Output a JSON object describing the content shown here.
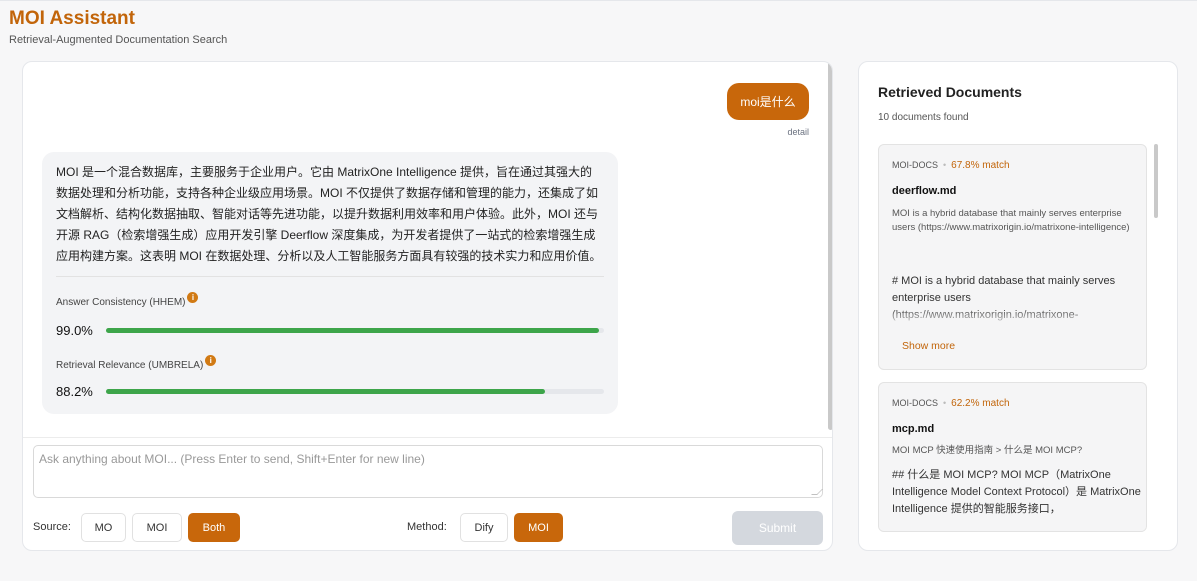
{
  "header": {
    "title": "MOI Assistant",
    "subtitle": "Retrieval-Augmented Documentation Search"
  },
  "chat": {
    "user_message": "moi是什么",
    "detail_label": "detail",
    "answer": "MOI 是一个混合数据库，主要服务于企业用户。它由 MatrixOne Intelligence 提供，旨在通过其强大的数据处理和分析功能，支持各种企业级应用场景。MOI 不仅提供了数据存储和管理的能力，还集成了如文档解析、结构化数据抽取、智能对话等先进功能，以提升数据利用效率和用户体验。此外，MOI 还与开源 RAG（检索增强生成）应用开发引擎 Deerflow 深度集成，为开发者提供了一站式的检索增强生成应用构建方案。这表明 MOI 在数据处理、分析以及人工智能服务方面具有较强的技术实力和应用价值。",
    "metrics": [
      {
        "label": "Answer Consistency (HHEM)",
        "value_text": "99.0%",
        "fraction": 0.99,
        "info_icon": "info-icon"
      },
      {
        "label": "Retrieval Relevance (UMBRELA)",
        "value_text": "88.2%",
        "fraction": 0.882,
        "info_icon": "info-icon"
      }
    ],
    "colors": {
      "accent": "#c8670b",
      "metric_fill": "#3da54a"
    }
  },
  "composer": {
    "placeholder": "Ask anything about MOI... (Press Enter to send, Shift+Enter for new line)",
    "value": "",
    "source_label": "Source:",
    "source_options": [
      "MO",
      "MOI",
      "Both"
    ],
    "source_selected": "Both",
    "method_label": "Method:",
    "method_options": [
      "Dify",
      "MOI"
    ],
    "method_selected": "MOI",
    "submit_label": "Submit"
  },
  "documents": {
    "title": "Retrieved Documents",
    "count_text": "10 documents found",
    "items": [
      {
        "source": "MOI-DOCS",
        "separator": "•",
        "match": "67.8% match",
        "name": "deerflow.md",
        "summary": "MOI is a hybrid database that mainly serves enterprise users (https://www.matrixorigin.io/matrixone-intelligence)",
        "body": "# MOI is a hybrid database that mainly serves enterprise users (https://www.matrixorigin.io/matrixone-",
        "show_more": "Show more"
      },
      {
        "source": "MOI-DOCS",
        "separator": "•",
        "match": "62.2% match",
        "name": "mcp.md",
        "summary": "MOI MCP 快速使用指南 > 什么是 MOI MCP?",
        "body": "## 什么是 MOI MCP?  MOI MCP（MatrixOne Intelligence Model Context Protocol）是 MatrixOne Intelligence 提供的智能服务接口，"
      }
    ]
  }
}
